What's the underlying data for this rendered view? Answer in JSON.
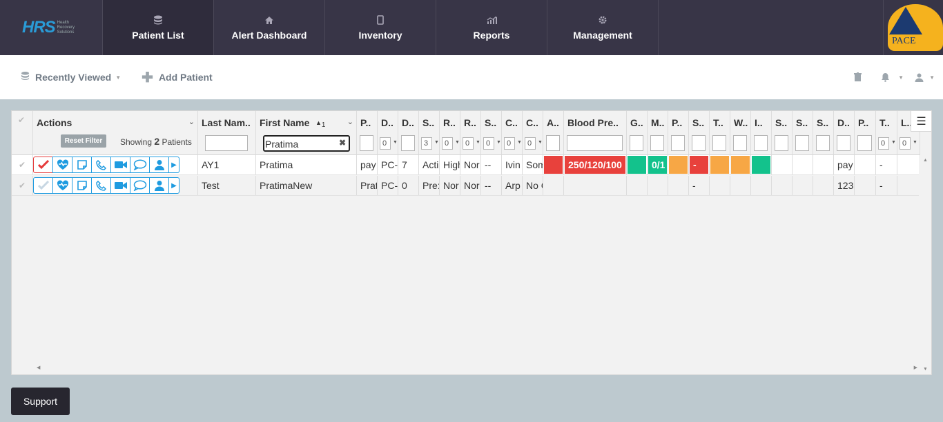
{
  "app": {
    "logo_text": "HRS",
    "logo_sub": "Health Recovery Solutions",
    "brand_text": "PACE"
  },
  "nav": {
    "tabs": [
      {
        "label": "Patient List",
        "icon": "database-icon"
      },
      {
        "label": "Alert Dashboard",
        "icon": "home-icon"
      },
      {
        "label": "Inventory",
        "icon": "tablet-icon"
      },
      {
        "label": "Reports",
        "icon": "chart-icon"
      },
      {
        "label": "Management",
        "icon": "gear-icon"
      }
    ],
    "active": "Patient List"
  },
  "toolbar": {
    "recently_viewed": "Recently Viewed",
    "add_patient": "Add Patient"
  },
  "grid": {
    "actions_header": "Actions",
    "reset_filter": "Reset Filter",
    "showing_prefix": "Showing",
    "showing_count": "2",
    "showing_suffix": "Patients",
    "headers": [
      "Last Nam..",
      "First Name",
      "P..",
      "D..",
      "D..",
      "S..",
      "R..",
      "R..",
      "S..",
      "C..",
      "C..",
      "A..",
      "Blood Pre..",
      "G..",
      "M..",
      "P..",
      "S..",
      "T..",
      "W..",
      "I..",
      "S..",
      "S..",
      "S..",
      "D..",
      "P..",
      "T..",
      "L.."
    ],
    "sort_indicator": "1",
    "first_name_filter": "Pratima",
    "select_defaults": {
      "d2": "0",
      "s": "3",
      "r1": "0",
      "r2": "0",
      "s2": "0",
      "c1": "0",
      "c2": "0",
      "t": "0",
      "l": "0"
    },
    "rows": [
      {
        "last": "AY1",
        "first": "Pratima",
        "p": "pay",
        "d1": "PC-",
        "d2": "7",
        "s": "Acti",
        "r1": "High",
        "r2": "Nor",
        "s2": "--",
        "c1": "Ivin",
        "c2": "Som",
        "bp": "250/120/100",
        "m": "0/1",
        "s3": "-",
        "s7": "pay",
        "p2": "-"
      },
      {
        "last": "Test",
        "first": "PratimaNew",
        "p": "Prat",
        "d1": "PC-",
        "d2": "0",
        "s": "Pre:",
        "r1": "Nor",
        "r2": "Nor",
        "s2": "--",
        "c1": "Arp",
        "c2": "No C",
        "bp": "",
        "m": "",
        "s3": "-",
        "s7": "123",
        "p2": "-"
      }
    ]
  },
  "colors": {
    "red": "#e8413c",
    "green": "#13c28c",
    "orange": "#f7a745",
    "nav_bg": "#383547",
    "accent": "#1e9be0"
  },
  "support": {
    "label": "Support"
  }
}
